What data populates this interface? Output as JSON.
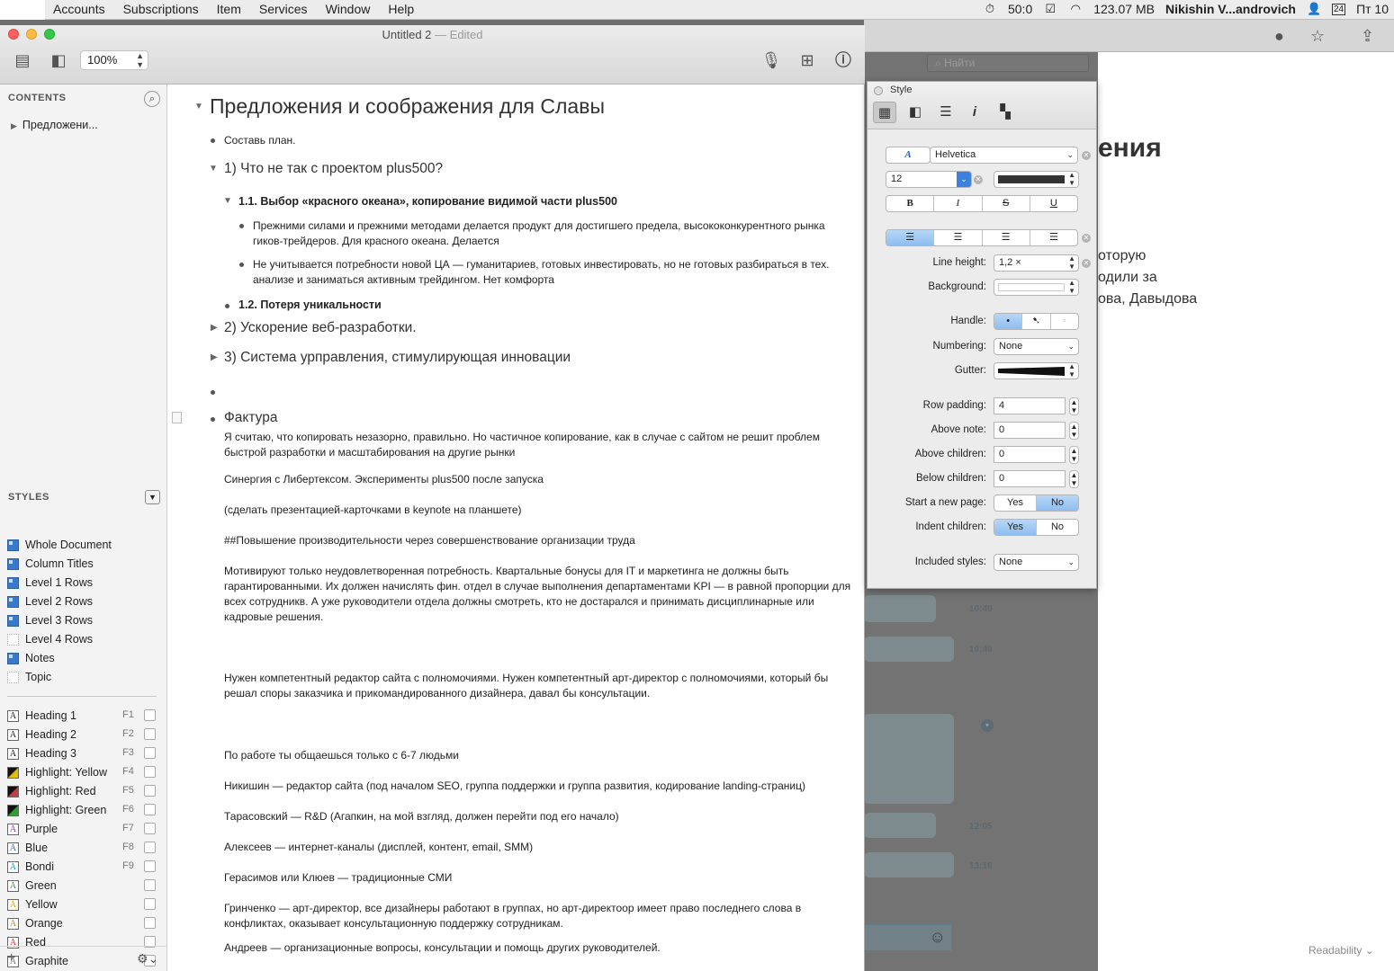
{
  "menubar": {
    "menus": [
      "Accounts",
      "Subscriptions",
      "Item",
      "Services",
      "Window",
      "Help"
    ],
    "status": {
      "battery": "50:0",
      "memory": "123.07 MB",
      "user": "Nikishin V...androvich",
      "calendar_day": "24",
      "clock": "Пт 10"
    }
  },
  "window": {
    "title": "Untitled 2",
    "state": "— Edited",
    "zoom": "100%"
  },
  "sidebar": {
    "contents_header": "CONTENTS",
    "contents_item": "Предложени...",
    "styles_header": "STYLES",
    "structure_styles": [
      {
        "label": "Whole Document",
        "swatch": "blue"
      },
      {
        "label": "Column Titles",
        "swatch": "blue"
      },
      {
        "label": "Level 1 Rows",
        "swatch": "blue"
      },
      {
        "label": "Level 2 Rows",
        "swatch": "blue"
      },
      {
        "label": "Level 3 Rows",
        "swatch": "blue"
      },
      {
        "label": "Level 4 Rows",
        "swatch": "empty"
      },
      {
        "label": "Notes",
        "swatch": "blue"
      },
      {
        "label": "Topic",
        "swatch": "empty"
      }
    ],
    "named_styles": [
      {
        "label": "Heading 1",
        "key": "F1",
        "color": "#222222"
      },
      {
        "label": "Heading 2",
        "key": "F2",
        "color": "#222222"
      },
      {
        "label": "Heading 3",
        "key": "F3",
        "color": "#222222"
      },
      {
        "label": "Highlight: Yellow",
        "key": "F4",
        "color": "#e0c000"
      },
      {
        "label": "Highlight: Red",
        "key": "F5",
        "color": "#c04040"
      },
      {
        "label": "Highlight: Green",
        "key": "F6",
        "color": "#30a030"
      },
      {
        "label": "Purple",
        "key": "F7",
        "color": "#8a3fb5"
      },
      {
        "label": "Blue",
        "key": "F8",
        "color": "#2f6fd0"
      },
      {
        "label": "Bondi",
        "key": "F9",
        "color": "#1a9cb0"
      },
      {
        "label": "Green",
        "key": "",
        "color": "#3a9b3a"
      },
      {
        "label": "Yellow",
        "key": "",
        "color": "#d6a800"
      },
      {
        "label": "Orange",
        "key": "",
        "color": "#e07b20"
      },
      {
        "label": "Red",
        "key": "",
        "color": "#d03030"
      },
      {
        "label": "Graphite",
        "key": "",
        "color": "#777777"
      }
    ]
  },
  "document": {
    "title": "Предложения и соображения для Славы",
    "item_plan": "Составь план.",
    "h1": "1) Что не так с проектом plus500?",
    "h11": "1.1. Выбор «красного океана», копирование видимой части plus500",
    "p1a": "Прежними силами и прежними методами делается продукт для достигшего предела, высококонкурентного рынка",
    "p1b": "гиков-трейдеров.  Для красного океана. Делается",
    "p2a": "Не учитывается потребности новой ЦА — гуманитариев, готовых инвестировать, но не готовых разбираться в тех.",
    "p2b": "анализе и заниматься активным трейдингом. Нет комфорта",
    "h12": "1.2. Потеря уникальности",
    "h2": "2) Ускорение веб-разработки.",
    "h3": "3) Система урправления, стимулирующая инновации",
    "fact_heading": "Фактура",
    "notes": [
      "Я считаю, что копировать незазорно, правильно. Но частичное копирование, как в случае с сайтом не решит проблем быстрой разработки и масштабирования на другие рынки",
      "Синергия с Либертексом. Эксперименты plus500 после запуска",
      "(сделать презентацией-карточками в keynote на планшете)",
      "##Повышение производительности через совершенствование организации труда",
      "Мотивируют только неудовлетворенная потребность. Квартальные бонусы для IT и маркетинга не должны быть гарантированными. Их должен начислять фин. отдел в случае выполнения департаментами KPI — в равной пропорции для всех сотрудникв. А уже руководители отдела должны смотреть, кто не достарался и принимать дисциплинарные или кадровые решения.",
      "Нужен компетентный редактор сайта с полномочиями. Нужен компетентный арт-директор с полномочиями, который бы решал споры заказчика и прикомандированного дизайнера, давал бы консультации.",
      "По работе ты общаешься только с 6-7 людьми",
      "Никишин — редактор сайта (под началом SEO, группа поддержки и группа развития, кодирование landing-страниц)",
      "Тарасовский — R&D (Агапкин, на мой взгляд, должен перейти под его начало)",
      "Алексеев — интернет-каналы (дисплей, контент, email, SMM)",
      "Герасимов или Клюев — традиционные СМИ",
      "Гринченко — арт-директор, все дизайнеры работают в группах, но арт-директоор имеет право последнего слова в конфликтах, оказывает консультационную поддержку сотрудникам.",
      "Андреев — организационные вопросы, консультации и помощь других руководителей."
    ]
  },
  "inspector": {
    "title": "Style",
    "font": "Helvetica",
    "size": "12",
    "bold": "B",
    "italic": "I",
    "strike": "S",
    "underline": "U",
    "line_height_label": "Line height:",
    "line_height": "1,2 ×",
    "background_label": "Background:",
    "handle_label": "Handle:",
    "numbering_label": "Numbering:",
    "numbering": "None",
    "gutter_label": "Gutter:",
    "row_padding_label": "Row padding:",
    "row_padding": "4",
    "above_note_label": "Above note:",
    "above_note": "0",
    "above_children_label": "Above children:",
    "above_children": "0",
    "below_children_label": "Below children:",
    "below_children": "0",
    "new_page_label": "Start a new page:",
    "indent_label": "Indent children:",
    "yes": "Yes",
    "no": "No",
    "included_label": "Included styles:",
    "included": "None"
  },
  "background_app": {
    "search_placeholder": "Найти",
    "reader_heading": "ения",
    "reader_lines": [
      "оторую",
      "одили за",
      "ова, Давыдова"
    ],
    "times": [
      "10:49",
      "10:49",
      "12:05",
      "13:16"
    ],
    "readability": "Readability"
  }
}
